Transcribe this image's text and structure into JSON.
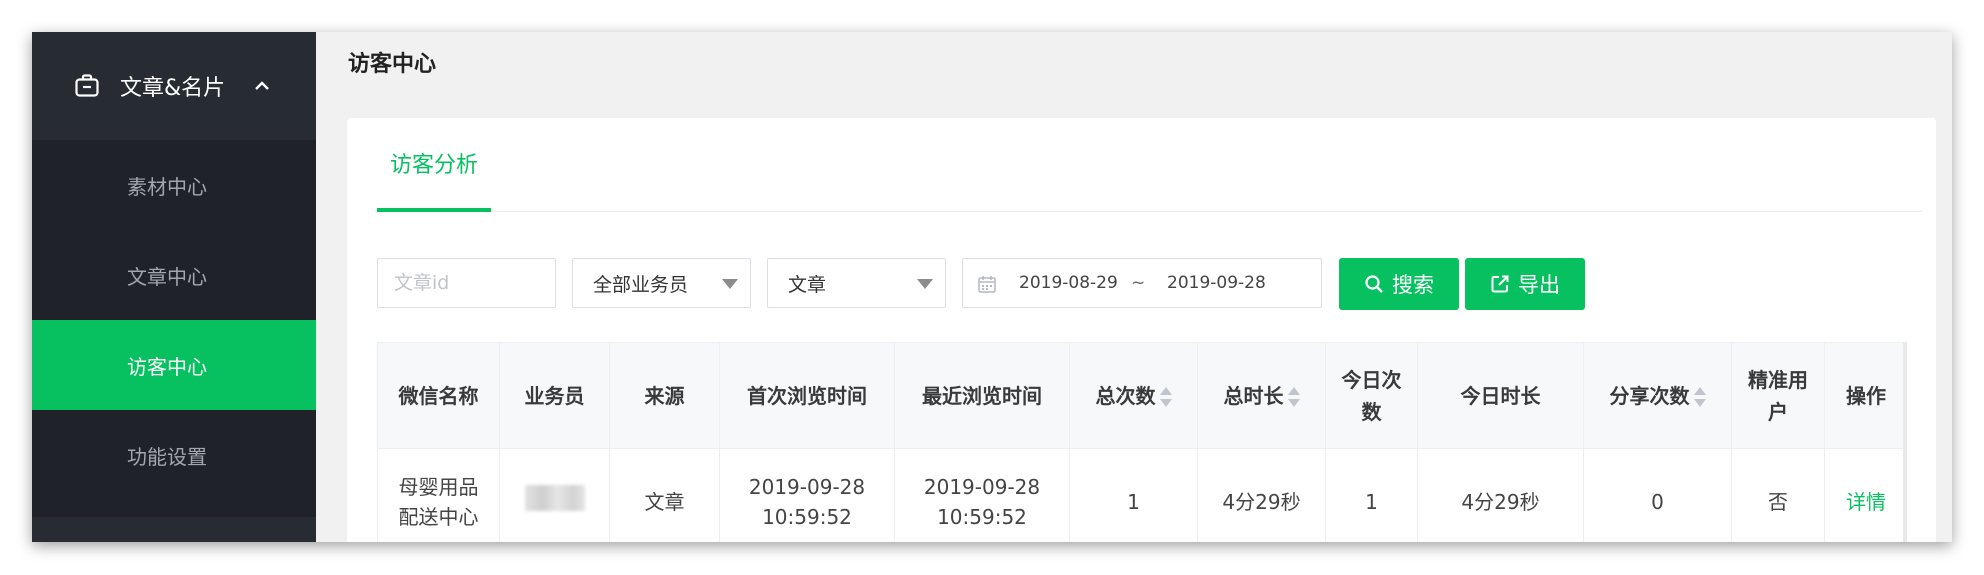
{
  "sidebar": {
    "header": {
      "icon": "briefcase-icon",
      "label": "文章&名片",
      "chevron": "chevron-up-icon"
    },
    "items": [
      {
        "label": "素材中心",
        "active": false
      },
      {
        "label": "文章中心",
        "active": false
      },
      {
        "label": "访客中心",
        "active": true
      },
      {
        "label": "功能设置",
        "active": false
      }
    ]
  },
  "page": {
    "title": "访客中心"
  },
  "tabs": [
    {
      "label": "访客分析",
      "active": true
    }
  ],
  "filters": {
    "article_id": {
      "value": "",
      "placeholder": "文章id"
    },
    "salesperson": {
      "selected": "全部业务员"
    },
    "source": {
      "selected": "文章"
    },
    "date_range": {
      "start": "2019-08-29",
      "separator": "~",
      "end": "2019-09-28"
    },
    "search_button": {
      "label": "搜索",
      "icon": "search-icon"
    },
    "export_button": {
      "label": "导出",
      "icon": "export-icon"
    }
  },
  "table": {
    "columns": [
      {
        "label": "微信名称",
        "sortable": false
      },
      {
        "label": "业务员",
        "sortable": false
      },
      {
        "label": "来源",
        "sortable": false
      },
      {
        "label": "首次浏览时间",
        "sortable": false
      },
      {
        "label": "最近浏览时间",
        "sortable": false
      },
      {
        "label": "总次数",
        "sortable": true
      },
      {
        "label": "总时长",
        "sortable": true
      },
      {
        "label": "今日次数",
        "sortable": false
      },
      {
        "label": "今日时长",
        "sortable": false
      },
      {
        "label": "分享次数",
        "sortable": true
      },
      {
        "label": "精准用户",
        "sortable": false
      },
      {
        "label": "操作",
        "sortable": false
      }
    ],
    "rows": [
      {
        "wechat_name": "母婴用品配送中心",
        "salesperson": "",
        "source": "文章",
        "first_visit": "2019-09-28 10:59:52",
        "last_visit": "2019-09-28 10:59:52",
        "total_count": "1",
        "total_duration": "4分29秒",
        "today_count": "1",
        "today_duration": "4分29秒",
        "share_count": "0",
        "precise_user": "否",
        "action": "详情"
      }
    ]
  },
  "colors": {
    "accent": "#07c160",
    "sidebar_bg": "#1f2329",
    "sidebar_header_bg": "#272b32"
  }
}
